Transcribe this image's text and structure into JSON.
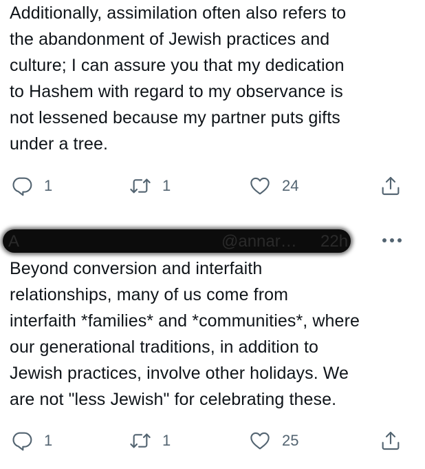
{
  "tweet1": {
    "text": "Additionally, assimilation often also refers to\nthe abandonment of Jewish practices and\nculture; I can assure you that my dedication\nto Hashem with regard to my observance is\nnot lessened because my partner puts gifts\nunder a tree.",
    "actions": {
      "replies": "1",
      "retweets": "1",
      "likes": "24"
    }
  },
  "tweet2": {
    "header": {
      "redacted_name": "A",
      "handle": "@annar…",
      "timestamp": "22h"
    },
    "text": "Beyond conversion and interfaith\nrelationships, many of us come from\ninterfaith *families* and *communities*, where\nour generational traditions, in addition to\nJewish practices, involve other holidays. We\nare not \"less Jewish\" for celebrating these.",
    "actions": {
      "replies": "1",
      "retweets": "1",
      "likes": "25"
    }
  },
  "icons": {
    "reply": "reply-icon",
    "retweet": "retweet-icon",
    "like": "heart-icon",
    "share": "share-icon",
    "more": "more-icon"
  },
  "colors": {
    "text": "#0f1419",
    "muted": "#536471",
    "background": "#ffffff"
  }
}
